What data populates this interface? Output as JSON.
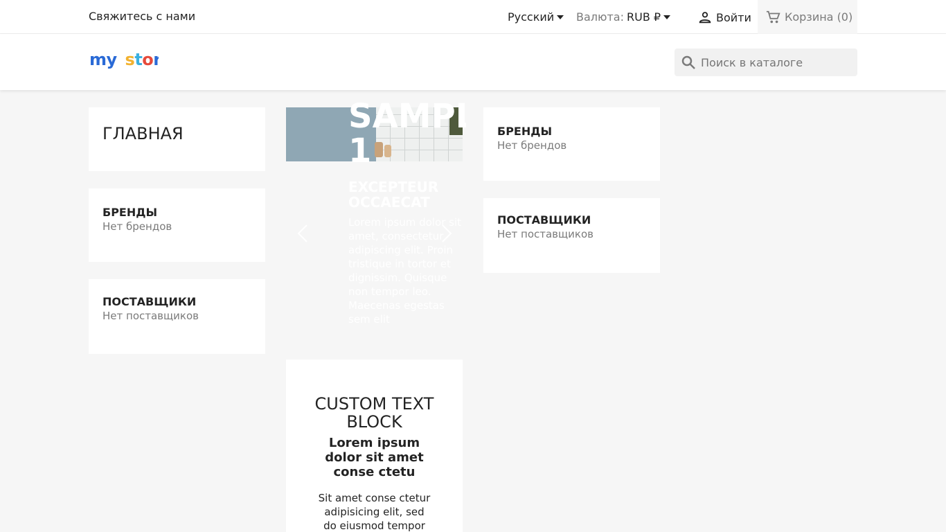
{
  "topbar": {
    "contact": "Свяжитесь с нами",
    "language": "Русский",
    "currency_label": "Валюта:",
    "currency_value": "RUB ₽",
    "signin": "Войти",
    "cart": "Корзина (0)"
  },
  "header": {
    "logo": "my store",
    "search_placeholder": "Поиск в каталоге"
  },
  "left_column": {
    "home": "ГЛАВНАЯ",
    "brands_title": "БРЕНДЫ",
    "brands_text": "Нет брендов",
    "suppliers_title": "ПОСТАВЩИКИ",
    "suppliers_text": "Нет поставщиков"
  },
  "slider": {
    "title_line1": "SAMPLE",
    "title_line2": "1",
    "subtitle": "EXCEPTEUR OCCAECAT",
    "text": "Lorem ipsum dolor sit amet, consectetur adipiscing elit. Proin tristique in tortor et dignissim. Quisque non tempor leo. Maecenas egestas sem elit"
  },
  "custom_block": {
    "title": "CUSTOM TEXT BLOCK",
    "subtitle": "Lorem ipsum dolor sit amet conse ctetu",
    "text": "Sit amet conse ctetur adipisicing elit, sed do eiusmod tempor"
  },
  "right_column": {
    "brands_title": "БРЕНДЫ",
    "brands_text": "Нет брендов",
    "suppliers_title": "ПОСТАВЩИКИ",
    "suppliers_text": "Нет поставщиков"
  },
  "colors": {
    "background": "#f6f6f6",
    "text": "#232323",
    "muted": "#7a7a7a"
  }
}
